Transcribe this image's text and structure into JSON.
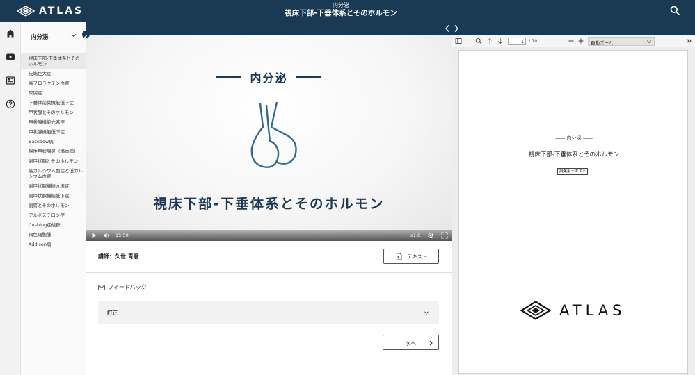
{
  "header": {
    "logo_text": "ATLAS",
    "subtitle": "内分泌",
    "title": "視床下部-下垂体系とそのホルモン"
  },
  "sidebar": {
    "heading": "内分泌",
    "items": [
      {
        "label": "視床下部-下垂体系とそのホルモン",
        "active": true
      },
      {
        "label": "先端巨大症"
      },
      {
        "label": "高プロラクチン血症"
      },
      {
        "label": "尿崩症"
      },
      {
        "label": "下垂体前葉機能低下症"
      },
      {
        "label": "甲状腺とそのホルモン"
      },
      {
        "label": "甲状腺機能亢進症"
      },
      {
        "label": "甲状腺機能低下症"
      },
      {
        "label": "Basedow病"
      },
      {
        "label": "慢性甲状腺炎（橋本病）"
      },
      {
        "label": "副甲状腺とそのホルモン"
      },
      {
        "label": "高カルシウム血症と低カルシウム血症"
      },
      {
        "label": "副甲状腺機能亢進症"
      },
      {
        "label": "副甲状腺機能低下症"
      },
      {
        "label": "副腎とそのホルモン"
      },
      {
        "label": "アルドステロン症"
      },
      {
        "label": "Cushing症候群"
      },
      {
        "label": "褐色細胞腫"
      },
      {
        "label": "Addison病"
      }
    ]
  },
  "video": {
    "section": "内分泌",
    "title": "視床下部-下垂体系とそのホルモン",
    "time": "15:50",
    "speed": "x1.0"
  },
  "lecture": {
    "lecturer": "講師：久世 青意",
    "text_button": "テキスト",
    "feedback": "フィードバック",
    "accordion_label": "訂正",
    "next_button": "次へ"
  },
  "pdf": {
    "page_current": "1",
    "page_total": "/ 10",
    "zoom": "自動ズーム",
    "page_section": "―― 内分泌 ――",
    "page_title": "視床下部-下垂体系とそのホルモン",
    "page_badge": "授業用テキスト",
    "page_logo": "ATLAS"
  },
  "colors": {
    "navy": "#1a3a54",
    "slide_text": "#1d3a52",
    "illustration": "#2e6a92"
  }
}
